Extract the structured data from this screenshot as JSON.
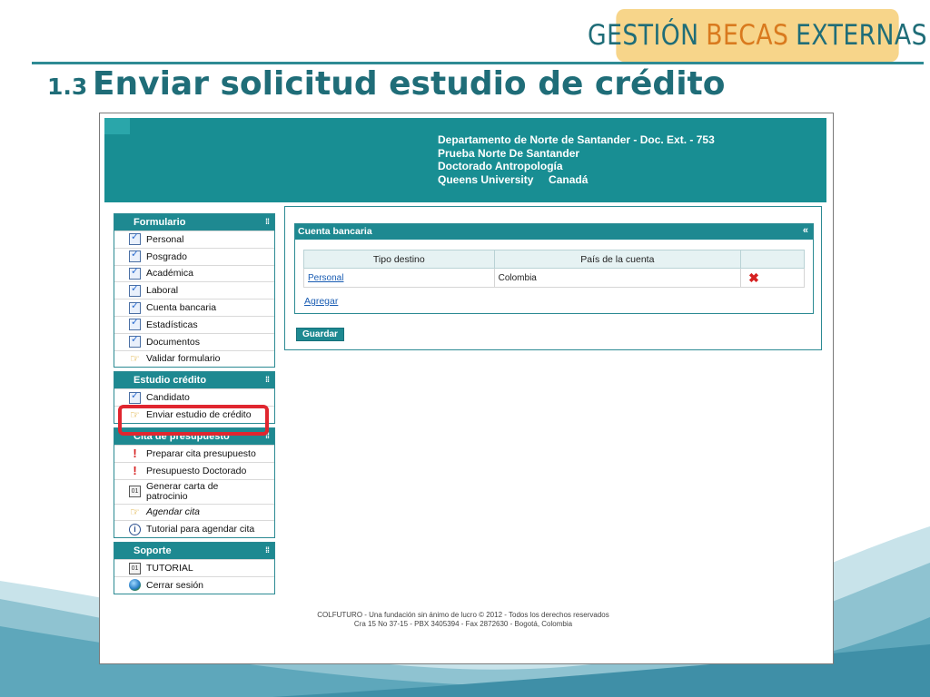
{
  "brand": {
    "part1": "GESTIÓN",
    "part2": "BECAS",
    "part3": "EXTERNAS"
  },
  "slide": {
    "number": "1.3",
    "title": "Enviar solicitud estudio de crédito"
  },
  "header": {
    "line1": "Departamento de Norte de Santander - Doc. Ext. - 753",
    "line2": "Prueba Norte De Santander",
    "line3": "Doctorado Antropología",
    "line4": "Queens University     Canadá"
  },
  "sidebar": {
    "formulario": {
      "title": "Formulario",
      "items": [
        "Personal",
        "Posgrado",
        "Académica",
        "Laboral",
        "Cuenta bancaria",
        "Estadísticas",
        "Documentos",
        "Validar formulario"
      ]
    },
    "estudio": {
      "title": "Estudio crédito",
      "items": [
        "Candidato",
        "Enviar estudio de crédito"
      ]
    },
    "cita": {
      "title": "Cita de presupuesto",
      "items": [
        "Preparar cita presupuesto",
        "Presupuesto Doctorado",
        "Generar carta de patrocinio",
        "Agendar cita",
        "Tutorial para agendar cita"
      ]
    },
    "soporte": {
      "title": "Soporte",
      "items": [
        "TUTORIAL",
        "Cerrar sesión"
      ]
    },
    "icons": {
      "doc": "document-check-icon",
      "hand": "pointing-hand-icon",
      "warn": "exclamation-icon",
      "calendar": "calendar-icon",
      "info": "info-icon",
      "globe": "globe-icon"
    }
  },
  "bank_panel": {
    "title": "Cuenta bancaria",
    "collapse": "«",
    "columns": [
      "Tipo destino",
      "País de la cuenta",
      ""
    ],
    "rows": [
      {
        "tipo": "Personal",
        "pais": "Colombia"
      }
    ],
    "add_label": "Agregar"
  },
  "save_label": "Guardar",
  "footer": {
    "line1": "COLFUTURO - Una fundación sin ánimo de lucro © 2012 - Todos los derechos reservados",
    "line2": "Cra 15 No 37-15 - PBX 3405394 - Fax 2872630 - Bogotá, Colombia"
  },
  "colors": {
    "teal": "#1e8991",
    "header_teal": "#188e93",
    "brand_bg": "#f7d58a",
    "highlight": "#e0262f"
  }
}
